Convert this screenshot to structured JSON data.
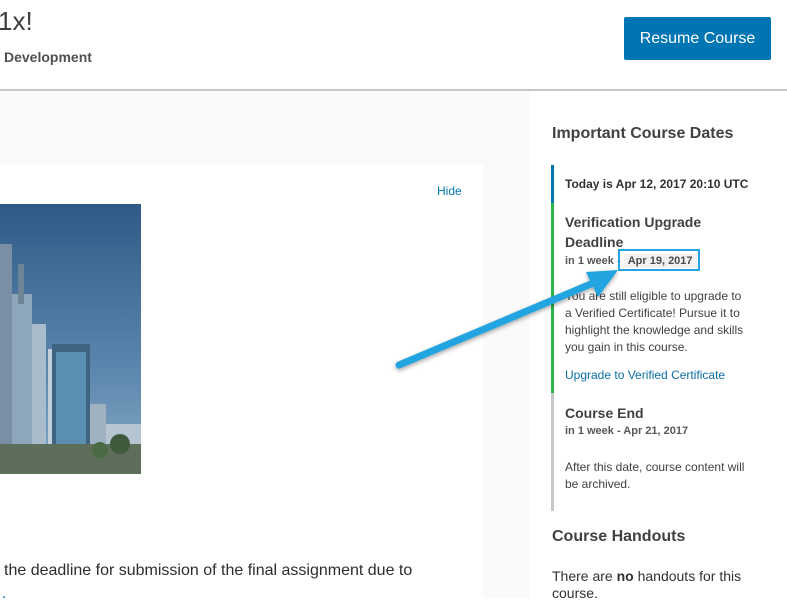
{
  "header": {
    "title": "1x!",
    "subtitle": "Development",
    "resume_label": "Resume Course"
  },
  "main": {
    "hide_label": "Hide",
    "body_line1": "l the deadline for submission of the final assignment due to",
    "body_line2": "."
  },
  "sidebar": {
    "dates_heading": "Important Course Dates",
    "today": "Today is Apr 12, 2017 20:10 UTC",
    "events": [
      {
        "title_line1": "Verification Upgrade",
        "title_line2": "Deadline",
        "relative": "in 1 week",
        "separator": " -",
        "date": "Apr 19, 2017",
        "desc_lines": [
          "You are still eligible to upgrade to",
          "a Verified Certificate! Pursue it to",
          "highlight the knowledge and skills",
          "you gain in this course."
        ],
        "link_label": "Upgrade to Verified Certificate"
      },
      {
        "title": "Course End",
        "date_text": "in 1 week - Apr 21, 2017",
        "desc_lines": [
          "After this date, course content will",
          "be archived."
        ]
      }
    ],
    "handouts_heading": "Course Handouts",
    "handouts_pre": "There are ",
    "handouts_bold": "no",
    "handouts_post": " handouts for this",
    "handouts_line2": "course."
  },
  "colors": {
    "accent": "#0075b4",
    "timeline_today": "#0075b4",
    "timeline_verified": "#2cb34a",
    "timeline_end": "#c8c8c8",
    "annotation": "#23a4e0"
  }
}
